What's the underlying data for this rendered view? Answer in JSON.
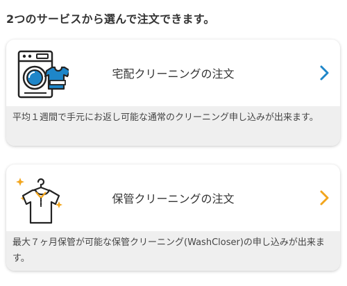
{
  "heading": "2つのサービスから選んで注文できます。",
  "colors": {
    "accent_blue": "#1e86c9",
    "accent_orange": "#f2a51c"
  },
  "cards": [
    {
      "icon": "washing-machine-icon",
      "title": "宅配クリーニングの注文",
      "description": "平均１週間で手元にお返し可能な通常のクリーニング申し込みが出来ます。",
      "chevron_color": "blue"
    },
    {
      "icon": "shirt-hanger-icon",
      "title": "保管クリーニングの注文",
      "description": "最大７ヶ月保管が可能な保管クリーニング(WashCloser)の申し込みが出来ます。",
      "chevron_color": "orange"
    }
  ]
}
